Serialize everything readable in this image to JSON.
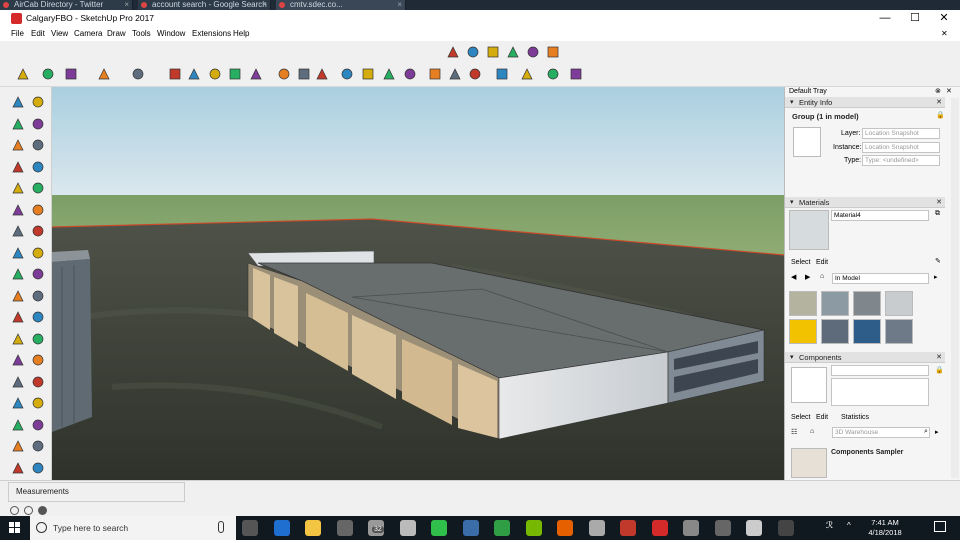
{
  "browser_tabs": [
    {
      "label": "AirCab Directory - Twitter",
      "x": ""
    },
    {
      "label": "account search - Google Search",
      "x": ""
    },
    {
      "label": "cmtv.sdec.co...",
      "x": ""
    }
  ],
  "window": {
    "title": "CalgaryFBO - SketchUp Pro 2017",
    "minimize": "—",
    "maximize": "☐",
    "close": "✕",
    "inner_close": "✕"
  },
  "menu": [
    "File",
    "Edit",
    "View",
    "Camera",
    "Draw",
    "Tools",
    "Window",
    "Extensions",
    "Help"
  ],
  "icons": {
    "top_row": [
      "tape-measure-icon",
      "protractor-icon",
      "paint-bucket-icon",
      "text-icon",
      "axes-icon",
      "3d-text-icon"
    ],
    "main_row": [
      "select-icon",
      "eraser-icon",
      "line-icon",
      "arc-icon",
      "rectangle-icon",
      "push-pull-icon",
      "follow-me-icon",
      "move-icon",
      "rotate-icon",
      "scale-icon",
      "tape-icon",
      "dimension-icon",
      "protractor-icon",
      "orbit-icon",
      "pan-icon",
      "zoom-icon",
      "zoom-extents-icon",
      "warehouse-icon",
      "share-model-icon",
      "extension-icon",
      "ruby-icon",
      "add-location-icon",
      "terrain-icon",
      "sandbox-icon"
    ]
  },
  "tray": {
    "title": "Default Tray",
    "entity_info": {
      "header": "Entity Info",
      "selection": "Group (1 in model)",
      "layer_label": "Layer:",
      "layer_value": "Location Snapshot",
      "instance_label": "Instance:",
      "instance_value": "Location Snapshot",
      "type_label": "Type:",
      "type_value": "Type: <undefined>"
    },
    "materials": {
      "header": "Materials",
      "name": "Material4",
      "tab_select": "Select",
      "tab_edit": "Edit",
      "library": "In Model"
    },
    "components": {
      "header": "Components",
      "tab_select": "Select",
      "tab_edit": "Edit",
      "tab_statistics": "Statistics",
      "search_placeholder": "3D Warehouse",
      "sampler_label": "Components Sampler"
    }
  },
  "status": {
    "measurements_label": "Measurements"
  },
  "taskbar": {
    "search_placeholder": "Type here to search",
    "time": "7:41 AM",
    "date": "4/18/2018",
    "tray_badge": "32"
  },
  "colors": {
    "accent": "#d42a2a",
    "sky_top": "#a9cfe0",
    "sky_bottom": "#dde8ee",
    "ground_far": "#7c9f67",
    "ground_near": "#3d4035",
    "taskbar": "#101820"
  }
}
